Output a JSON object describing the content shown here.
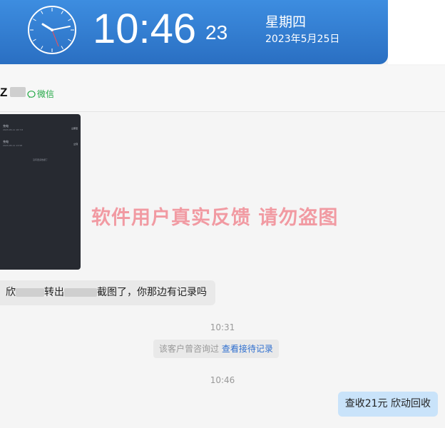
{
  "clock": {
    "time": "10:46",
    "seconds": "23",
    "weekday": "星期四",
    "date": "2023年5月25日"
  },
  "chat": {
    "contact_initial": "Z",
    "channel_label": "微信",
    "watermark": "软件用户真实反馈  请勿盗图",
    "screenshot_image": {
      "rows": [
        {
          "title": "充电",
          "sub": "2023-05-11 18:7:8",
          "right": "立即回"
        },
        {
          "title": "充电",
          "sub": "2023-05-11 13:58",
          "right": "立刻"
        }
      ],
      "footer": "没有更多数据了"
    },
    "incoming_message": {
      "part1": "欣",
      "part2": "转出",
      "part3": "截图了，你那边有记录吗"
    },
    "timestamp1": "10:31",
    "system_notice": {
      "text": "该客户曾咨询过",
      "link": "查看接待记录"
    },
    "timestamp2": "10:46",
    "outgoing_message": "查收21元 欣动回收"
  },
  "colors": {
    "banner": "#2f7fd6",
    "watermark": "#f19aa2",
    "outgoing_bubble": "#c9e3fa",
    "link": "#2f6fcf",
    "wechat": "#23a845"
  }
}
